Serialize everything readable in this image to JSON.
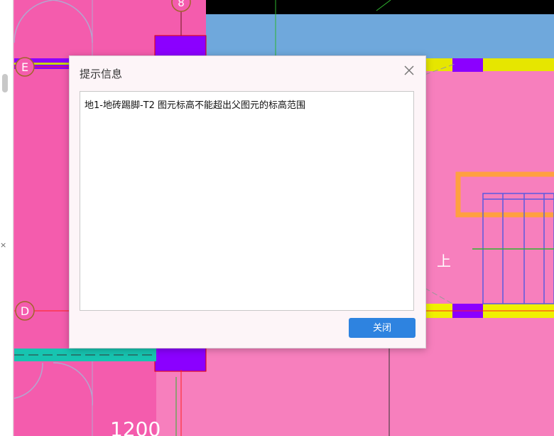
{
  "canvas": {
    "grid_labels": [
      "8",
      "E",
      "D"
    ],
    "dimension_text": "1200",
    "stair_text": "上"
  },
  "dialog": {
    "title": "提示信息",
    "message": "地1-地砖踢脚-T2 图元标高不能超出父图元的标高范围",
    "close_button_label": "关闭",
    "close_icon": "close-icon"
  },
  "left_panel": {
    "close_glyph": "×"
  },
  "colors": {
    "canvas_pink": "#f77fbd",
    "blue_area": "#6fa8dc",
    "purple_column": "#8b00ff",
    "button_blue": "#2e83e0"
  }
}
